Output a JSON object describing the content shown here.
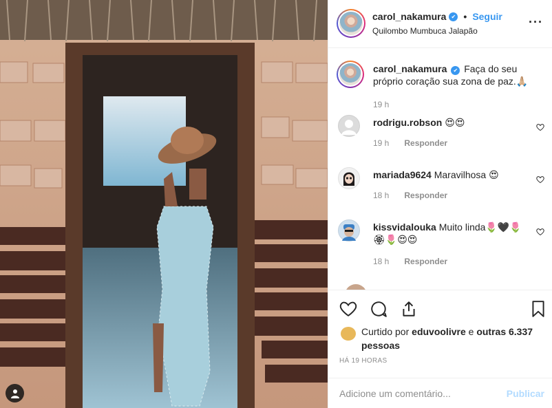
{
  "post": {
    "username": "carol_nakamura",
    "verified_symbol": "✔",
    "dot": "•",
    "follow_label": "Seguir",
    "location": "Quilombo Mumbuca Jalapão",
    "more_label": "···"
  },
  "caption": {
    "username": "carol_nakamura",
    "text": "Faça do seu próprio coração sua zona de paz.🙏🏼",
    "time": "19 h"
  },
  "comments": [
    {
      "username": "rodrigu.robson",
      "text": "😍😍",
      "time": "19 h",
      "reply_label": "Responder"
    },
    {
      "username": "mariada9624",
      "text": "Maravilhosa 😍",
      "time": "18 h",
      "reply_label": "Responder"
    },
    {
      "username": "kissvidalouka",
      "text": "Muito linda🌷🖤🌷🏵🌷😍😍",
      "time": "18 h",
      "reply_label": "Responder"
    }
  ],
  "likes": {
    "prefix": "Curtido por",
    "user": "eduvoolivre",
    "middle": "e",
    "others": "outras 6.337 pessoas"
  },
  "timestamp": "HÁ 19 HORAS",
  "composer": {
    "placeholder": "Adicione um comentário...",
    "publish_label": "Publicar"
  },
  "colors": {
    "link_blue": "#3897f0",
    "publish_disabled": "#b3dbff",
    "muted": "#8e8e8e"
  },
  "icons": [
    "heart-icon",
    "comment-icon",
    "share-icon",
    "bookmark-icon",
    "user-tag-icon",
    "verified-badge-icon"
  ]
}
